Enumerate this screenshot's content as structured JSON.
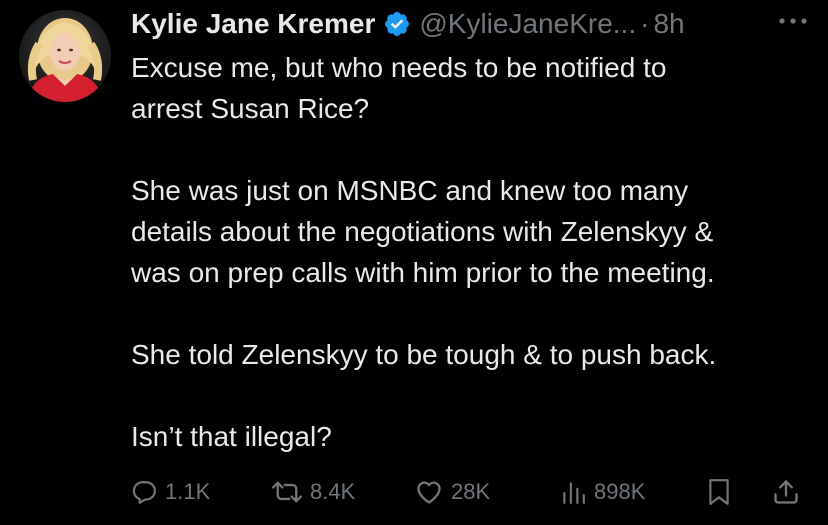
{
  "tweet": {
    "author": {
      "display_name": "Kylie Jane Kremer",
      "handle": "@KylieJaneKre...",
      "separator": "·",
      "time": "8h",
      "verified_icon": "verified-badge-icon",
      "verified_color": "#1d9bf0"
    },
    "paragraphs": [
      "Excuse me, but who needs to be notified to\narrest Susan Rice?",
      "She was just on MSNBC and knew too many\ndetails about the negotiations with Zelenskyy &\nwas on prep calls with him prior to the meeting.",
      "She told Zelenskyy to be tough & to push back.",
      "Isn’t that illegal?"
    ],
    "actions": {
      "reply": {
        "icon": "reply-icon",
        "count": "1.1K"
      },
      "retweet": {
        "icon": "retweet-icon",
        "count": "8.4K"
      },
      "like": {
        "icon": "heart-icon",
        "count": "28K"
      },
      "views": {
        "icon": "views-icon",
        "count": "898K"
      },
      "bookmark": {
        "icon": "bookmark-icon"
      },
      "share": {
        "icon": "share-icon"
      }
    }
  },
  "theme": {
    "background": "#000000",
    "text": "#e7e9ea",
    "secondary": "#71767b",
    "accent": "#1d9bf0"
  }
}
